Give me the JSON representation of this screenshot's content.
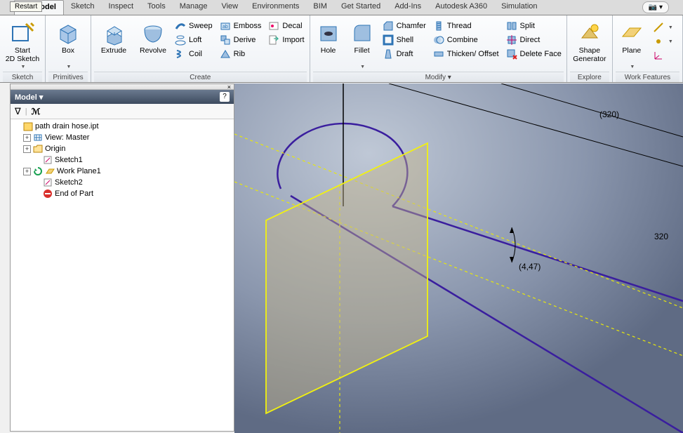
{
  "restart_tooltip": "Restart",
  "menu": {
    "tabs": [
      "3D Model",
      "Sketch",
      "Inspect",
      "Tools",
      "Manage",
      "View",
      "Environments",
      "BIM",
      "Get Started",
      "Add-Ins",
      "Autodesk A360",
      "Simulation"
    ],
    "active": 0,
    "end_dropdown": "📷 ▾"
  },
  "ribbon": {
    "sketch": {
      "title": "Sketch",
      "start": "Start\n2D Sketch"
    },
    "primitives": {
      "title": "Primitives",
      "box": "Box"
    },
    "create": {
      "title": "Create",
      "extrude": "Extrude",
      "revolve": "Revolve",
      "sweep": "Sweep",
      "loft": "Loft",
      "coil": "Coil",
      "emboss": "Emboss",
      "derive": "Derive",
      "rib": "Rib",
      "decal": "Decal",
      "import": "Import"
    },
    "modify": {
      "title": "Modify ▾",
      "hole": "Hole",
      "fillet": "Fillet",
      "chamfer": "Chamfer",
      "shell": "Shell",
      "draft": "Draft",
      "thread": "Thread",
      "combine": "Combine",
      "thicken": "Thicken/ Offset",
      "split": "Split",
      "direct": "Direct",
      "delete_face": "Delete Face"
    },
    "explore": {
      "title": "Explore",
      "shape_gen": "Shape\nGenerator"
    },
    "work": {
      "title": "Work Features",
      "plane": "Plane"
    }
  },
  "panel": {
    "title": "Model ▾",
    "close": "×",
    "help": "?",
    "filter_icon": "∇",
    "search_icon": "🔎"
  },
  "tree": {
    "root": "path drain hose.ipt",
    "view": "View: Master",
    "origin": "Origin",
    "sketch1": "Sketch1",
    "workplane1": "Work Plane1",
    "sketch2": "Sketch2",
    "end": "End of Part"
  },
  "viewport": {
    "dim1": "(320)",
    "dim2": "320",
    "dim3": "(4,47)"
  }
}
